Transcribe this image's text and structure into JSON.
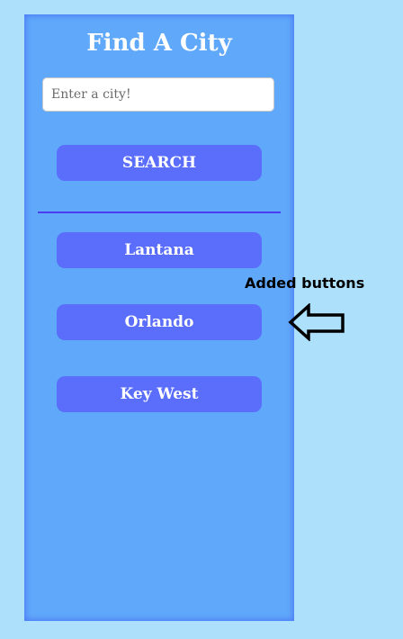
{
  "panel": {
    "title": "Find A City",
    "search_input": {
      "value": "",
      "placeholder": "Enter a city!"
    },
    "search_button_label": "SEARCH",
    "city_buttons": [
      "Lantana",
      "Orlando",
      "Key West"
    ]
  },
  "annotation": {
    "text": "Added buttons",
    "icon": "left-arrow-icon"
  },
  "colors": {
    "page_background": "#ade1fb",
    "panel_background": "#5fa8fa",
    "button": "#5a6efb",
    "divider": "#4a3ef0"
  }
}
